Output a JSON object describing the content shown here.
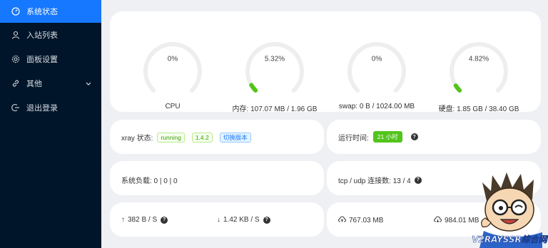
{
  "sidebar": {
    "items": [
      {
        "label": "系统状态",
        "icon": "dashboard-icon",
        "active": true
      },
      {
        "label": "入站列表",
        "icon": "user-icon"
      },
      {
        "label": "面板设置",
        "icon": "gear-icon"
      },
      {
        "label": "其他",
        "icon": "link-icon",
        "has_submenu": true
      },
      {
        "label": "退出登录",
        "icon": "logout-icon"
      }
    ]
  },
  "gauges": [
    {
      "value_text": "0%",
      "percent": 0,
      "label": "CPU"
    },
    {
      "value_text": "5.32%",
      "percent": 5.32,
      "label": "内存: 107.07 MB / 1.96 GB"
    },
    {
      "value_text": "0%",
      "percent": 0,
      "label": "swap: 0 B / 1024.00 MB"
    },
    {
      "value_text": "4.82%",
      "percent": 4.82,
      "label": "硬盘: 1.85 GB / 38.40 GB"
    }
  ],
  "xray": {
    "label": "xray 状态:",
    "status": "running",
    "version": "1.4.2",
    "switch_label": "切换版本"
  },
  "uptime": {
    "label": "运行时间:",
    "value": "21 小时",
    "help": "?"
  },
  "load": {
    "label": "系统负载: 0 | 0 | 0"
  },
  "connections": {
    "label": "tcp / udp 连接数: 13 / 4",
    "help": "?"
  },
  "speed": {
    "up": "382 B / S",
    "down": "1.42 KB / S",
    "help": "?"
  },
  "traffic": {
    "sent": "767.03 MB",
    "received": "984.01 MB",
    "help": "?"
  },
  "colors": {
    "sidebar_bg": "#001529",
    "active": "#1677ff",
    "gauge_fill": "#52c41a",
    "gauge_track": "#eeeeee"
  },
  "watermark": {
    "text": "V2RAYSSR综合网"
  }
}
